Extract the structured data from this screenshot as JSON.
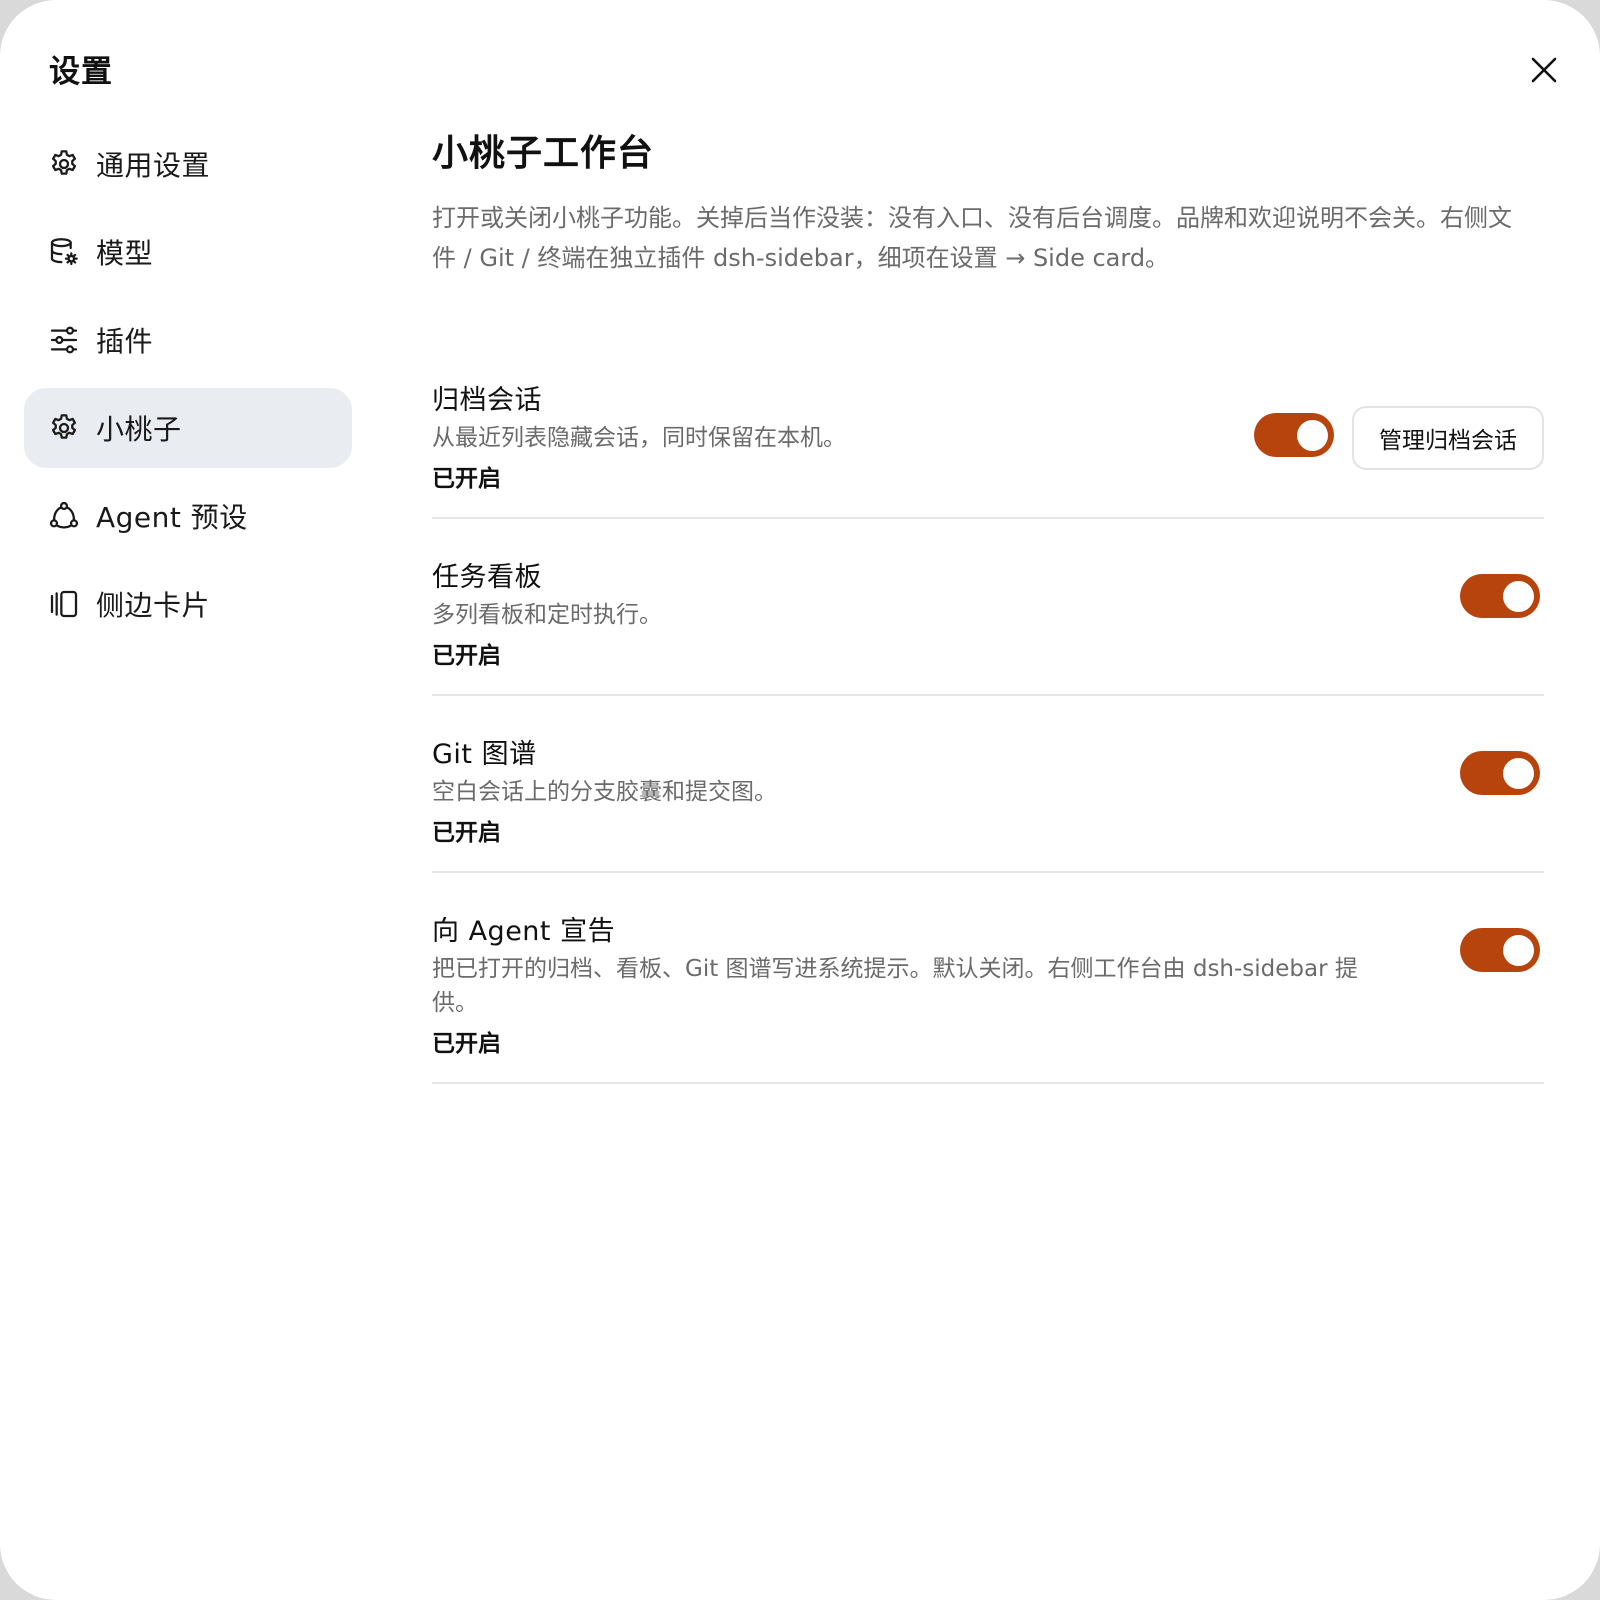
{
  "window": {
    "title": "设置"
  },
  "sidebar": {
    "items": [
      {
        "label": "通用设置",
        "icon": "gear-icon",
        "active": false
      },
      {
        "label": "模型",
        "icon": "database-gear-icon",
        "active": false
      },
      {
        "label": "插件",
        "icon": "sliders-icon",
        "active": false
      },
      {
        "label": "小桃子",
        "icon": "gear-icon",
        "active": true
      },
      {
        "label": "Agent 预设",
        "icon": "agent-nodes-icon",
        "active": false
      },
      {
        "label": "侧边卡片",
        "icon": "side-card-icon",
        "active": false
      }
    ]
  },
  "main": {
    "title": "小桃子工作台",
    "description": "打开或关闭小桃子功能。关掉后当作没装：没有入口、没有后台调度。品牌和欢迎说明不会关。右侧文件 / Git / 终端在独立插件 dsh-sidebar，细项在设置 → Side card。",
    "settings": [
      {
        "title": "归档会话",
        "description": "从最近列表隐藏会话，同时保留在本机。",
        "status": "已开启",
        "enabled": true,
        "button_label": "管理归档会话"
      },
      {
        "title": "任务看板",
        "description": "多列看板和定时执行。",
        "status": "已开启",
        "enabled": true
      },
      {
        "title": "Git 图谱",
        "description": "空白会话上的分支胶囊和提交图。",
        "status": "已开启",
        "enabled": true
      },
      {
        "title": "向 Agent 宣告",
        "description": "把已打开的归档、看板、Git 图谱写进系统提示。默认关闭。右侧工作台由 dsh-sidebar 提供。",
        "status": "已开启",
        "enabled": true
      }
    ]
  },
  "colors": {
    "accent": "#b8440d",
    "active_nav_bg": "#e9edf2",
    "muted_text": "#6b6b6b"
  }
}
